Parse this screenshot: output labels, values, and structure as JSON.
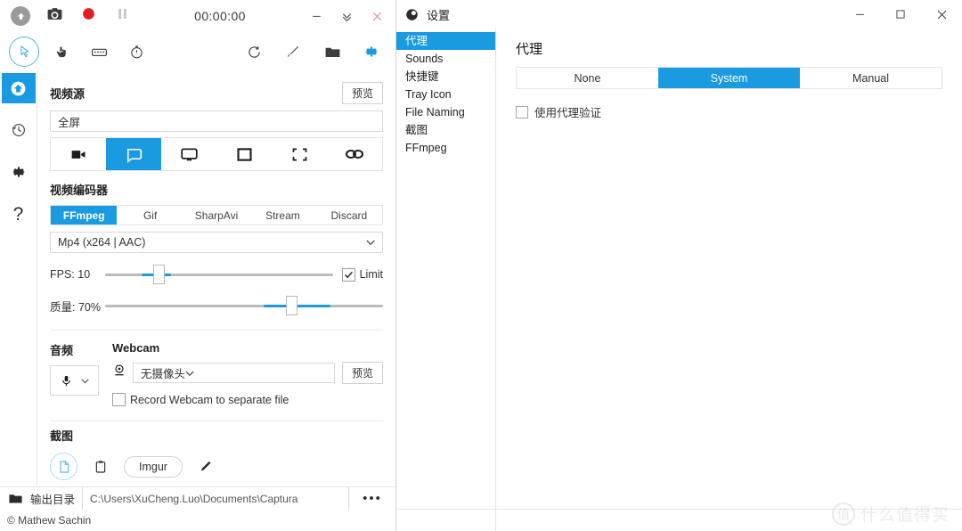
{
  "main_window": {
    "titlebar": {
      "logo_icon": "cloud-up-icon",
      "screenshot_label": "camera-icon",
      "record_label": "record-circle-icon",
      "pause_label": "pause-icon",
      "timer": "00:00:00",
      "minimize": "—",
      "collapse": "⌄⌄",
      "close": "×"
    },
    "toolbar": {
      "left_icons": [
        "cursor-icon",
        "hand-click-icon",
        "keyboard-icon",
        "stopwatch-icon"
      ],
      "right_icons": [
        "refresh-icon",
        "brush-icon",
        "folder-icon",
        "gear-icon"
      ]
    },
    "rail": {
      "items": [
        "home-icon",
        "history-icon",
        "settings-gear-icon",
        "help-icon"
      ],
      "active_index": 0
    },
    "video_source": {
      "title": "视频源",
      "preview_button": "预览",
      "selected_value": "全屏",
      "source_buttons": [
        {
          "name": "video-camera-icon",
          "selected": false
        },
        {
          "name": "screen-icon",
          "selected": true
        },
        {
          "name": "monitor-icon",
          "selected": false
        },
        {
          "name": "window-icon",
          "selected": false
        },
        {
          "name": "region-icon",
          "selected": false
        },
        {
          "name": "gamepad-icon",
          "selected": false
        }
      ]
    },
    "video_encoder": {
      "title": "视频编码器",
      "tabs": [
        "FFmpeg",
        "Gif",
        "SharpAvi",
        "Stream",
        "Discard"
      ],
      "selected_tab": 0,
      "codec_value": "Mp4 (x264 | AAC)"
    },
    "sliders": {
      "fps_label": "FPS: 10",
      "fps_percent": 22,
      "limit_label": "Limit",
      "limit_checked": true,
      "quality_label": "质量:  70%",
      "quality_percent": 70
    },
    "audio": {
      "title": "音频",
      "mic_icon": "microphone-icon"
    },
    "webcam": {
      "title": "Webcam",
      "icon": "webcam-icon",
      "selected_value": "无摄像头",
      "preview_button": "预览",
      "separate_file_label": "Record Webcam to separate file",
      "separate_file_checked": false
    },
    "screenshot": {
      "title": "截图",
      "disk_icon": "file-save-icon",
      "clipboard_icon": "clipboard-icon",
      "imgur_label": "Imgur",
      "edit_icon": "pencil-icon"
    },
    "output": {
      "folder_icon": "folder-icon",
      "label": "输出目录",
      "path": "C:\\Users\\XuCheng.Luo\\Documents\\Captura",
      "more_button": "•••"
    },
    "copyright": "© Mathew Sachin"
  },
  "settings_window": {
    "title": "设置",
    "title_icon": "captura-logo-icon",
    "minimize": "—",
    "maximize": "□",
    "close": "✕",
    "nav_items": [
      "代理",
      "Sounds",
      "快捷键",
      "Tray Icon",
      "File Naming",
      "截图",
      "FFmpeg"
    ],
    "nav_selected_index": 0,
    "page_title": "代理",
    "proxy_modes": [
      "None",
      "System",
      "Manual"
    ],
    "proxy_selected_index": 1,
    "auth_checkbox_label": "使用代理验证",
    "auth_checked": false
  },
  "watermark": {
    "logo": "值",
    "text": "什么值得买"
  },
  "colors": {
    "accent": "#1a9ae0",
    "record_red": "#e02020",
    "border": "#e1e4e6",
    "text": "#333333"
  }
}
